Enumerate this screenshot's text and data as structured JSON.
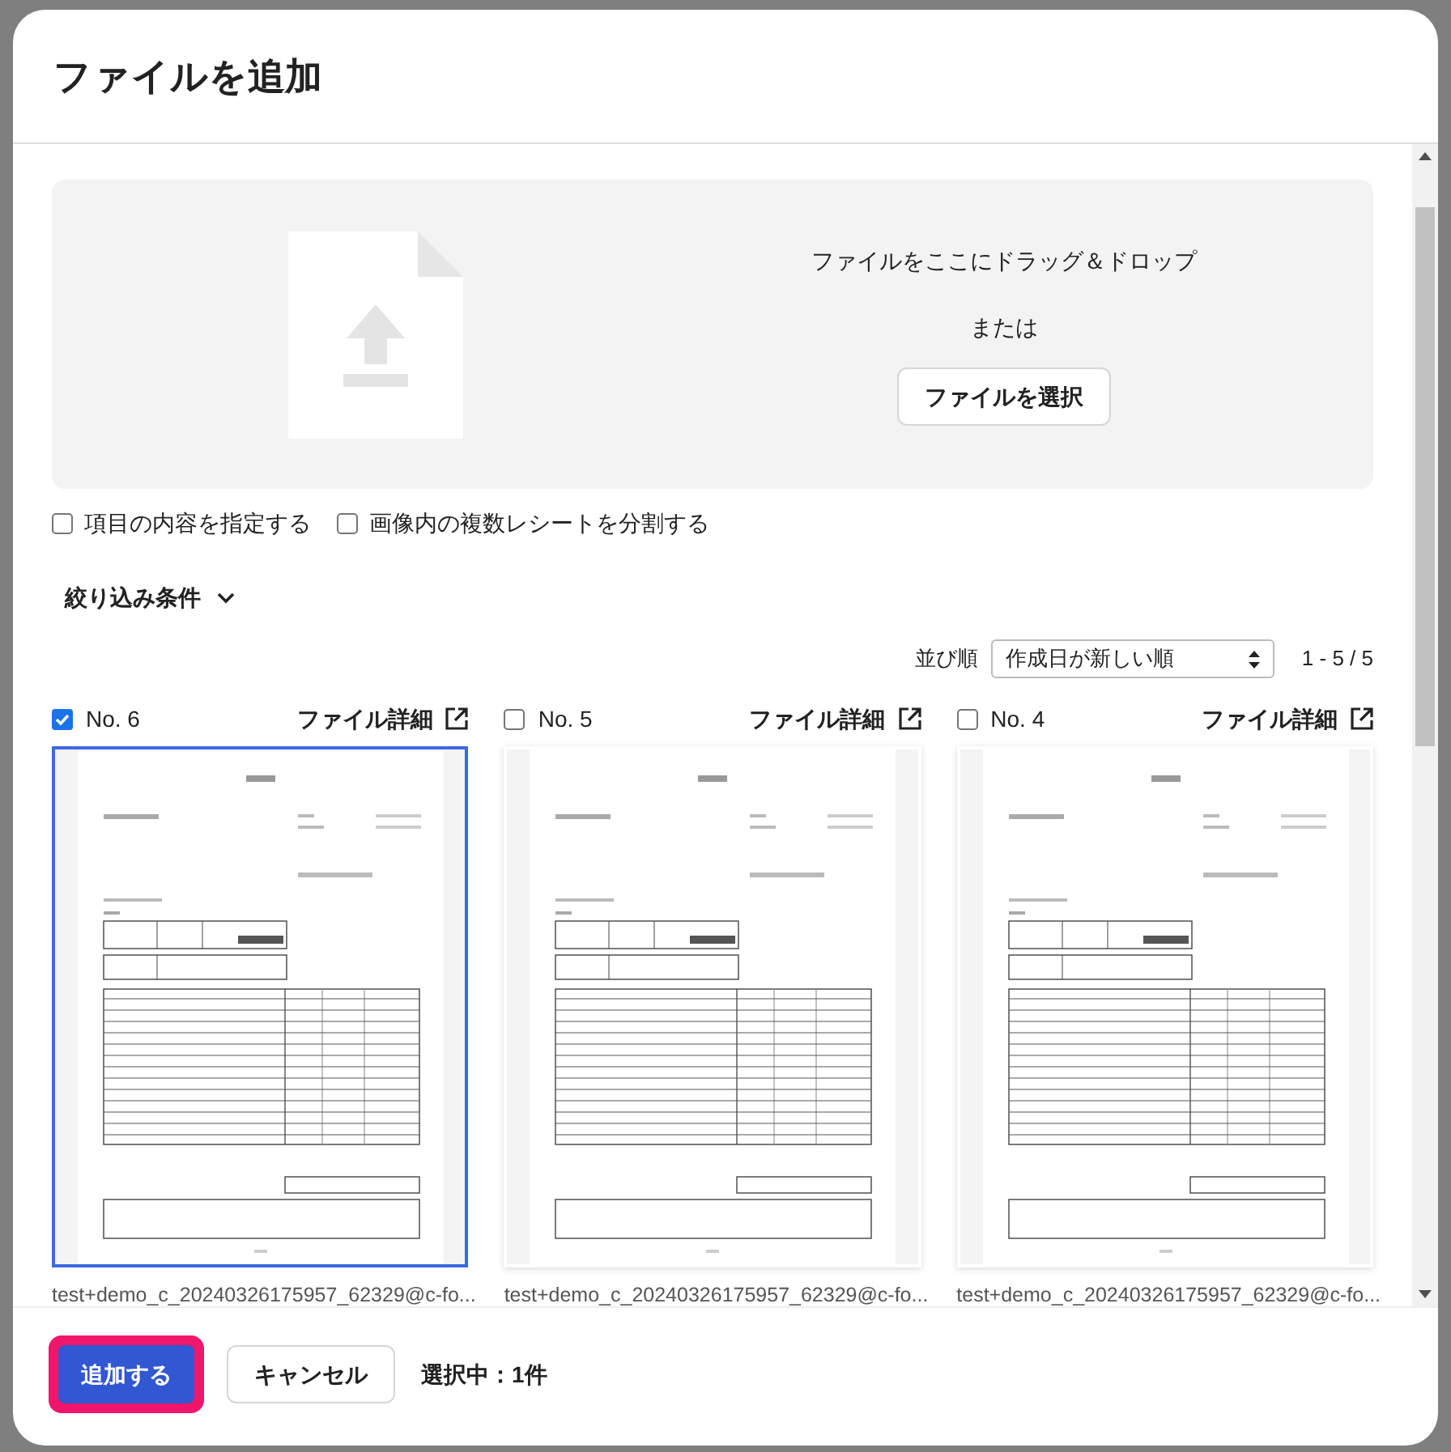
{
  "dialog": {
    "title": "ファイルを追加"
  },
  "dropzone": {
    "prompt": "ファイルをここにドラッグ＆ドロップ",
    "or": "または",
    "button": "ファイルを選択"
  },
  "options": [
    {
      "label": "項目の内容を指定する",
      "checked": false
    },
    {
      "label": "画像内の複数レシートを分割する",
      "checked": false
    }
  ],
  "filter": {
    "label": "絞り込み条件",
    "expanded": false
  },
  "sort": {
    "label": "並び順",
    "value": "作成日が新しい順",
    "count": "1 - 5 / 5"
  },
  "files": [
    {
      "number": "No. 6",
      "detail_link": "ファイル詳細",
      "selected": true,
      "filename": "test+demo_c_20240326175957_62329@c-fo..."
    },
    {
      "number": "No. 5",
      "detail_link": "ファイル詳細",
      "selected": false,
      "filename": "test+demo_c_20240326175957_62329@c-fo..."
    },
    {
      "number": "No. 4",
      "detail_link": "ファイル詳細",
      "selected": false,
      "filename": "test+demo_c_20240326175957_62329@c-fo..."
    }
  ],
  "footer": {
    "primary": "追加する",
    "cancel": "キャンセル",
    "selection": "選択中：1件"
  }
}
